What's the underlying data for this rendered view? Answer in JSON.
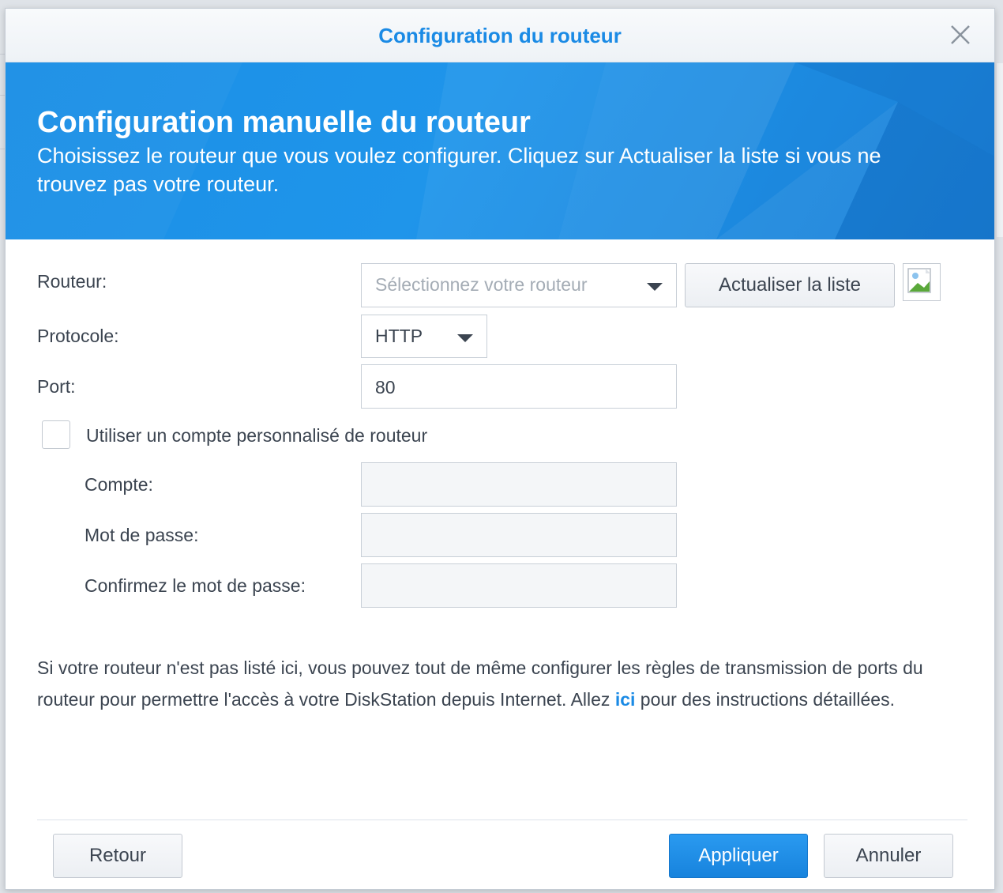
{
  "dialog": {
    "title": "Configuration du routeur"
  },
  "banner": {
    "heading": "Configuration manuelle du routeur",
    "description": "Choisissez le routeur que vous voulez configurer. Cliquez sur Actualiser la liste si vous ne trouvez pas votre routeur."
  },
  "form": {
    "router_label": "Routeur:",
    "router_placeholder": "Sélectionnez votre routeur",
    "refresh_button": "Actualiser la liste",
    "protocol_label": "Protocole:",
    "protocol_value": "HTTP",
    "port_label": "Port:",
    "port_value": "80",
    "custom_account_label": "Utiliser un compte personnalisé de routeur",
    "custom_account_checked": false,
    "account_label": "Compte:",
    "account_value": "",
    "password_label": "Mot de passe:",
    "password_value": "",
    "confirm_password_label": "Confirmez le mot de passe:",
    "confirm_password_value": ""
  },
  "note": {
    "text_before": "Si votre routeur n'est pas listé ici, vous pouvez tout de même configurer les règles de transmission de ports du routeur pour permettre l'accès à votre DiskStation depuis Internet. Allez ",
    "link": "ici",
    "text_after": " pour des instructions détaillées."
  },
  "footer": {
    "back_button": "Retour",
    "apply_button": "Appliquer",
    "cancel_button": "Annuler"
  },
  "colors": {
    "accent": "#1a8ae5",
    "banner": "#1f95ea",
    "primary_button": "#1f8ee8"
  }
}
